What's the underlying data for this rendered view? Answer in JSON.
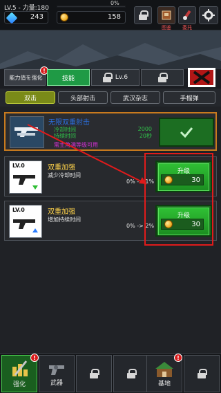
{
  "hud": {
    "level_power": "LV.5 - 力量:180",
    "progress_pct": "0%",
    "gems": "243",
    "gold": "158",
    "btn_illustrated_label": "图鉴",
    "btn_commission_label": "委托"
  },
  "tabs_top": [
    {
      "label": "能力值を强化"
    },
    {
      "label": "技能"
    },
    {
      "label": "Lv.6"
    },
    {
      "label": ""
    }
  ],
  "tabs_sub": [
    {
      "label": "双击"
    },
    {
      "label": "头部射击"
    },
    {
      "label": "武汉杂志"
    },
    {
      "label": "手榴弹"
    }
  ],
  "skill_active": {
    "title": "无限双重射击",
    "line1_label": "冷却时间",
    "line1_value": "2000",
    "line2_label": "持续时间",
    "line2_value": "20秒",
    "note": "需主角满等级可用"
  },
  "skills": [
    {
      "level": "LV.0",
      "name": "双重加强",
      "desc": "减少冷却时间",
      "change": "0% -> 1%",
      "button_label": "升级",
      "price": "30"
    },
    {
      "level": "LV.0",
      "name": "双重加强",
      "desc": "增加持续时间",
      "change": "0% -> 2%",
      "button_label": "升级",
      "price": "30"
    }
  ],
  "bottom_nav": [
    {
      "label": "强化"
    },
    {
      "label": "武器"
    },
    {
      "label": ""
    },
    {
      "label": ""
    },
    {
      "label": "基地"
    },
    {
      "label": ""
    }
  ],
  "colors": {
    "accent_green": "#2fbf34",
    "highlight_red": "#e11b1b",
    "active_tab": "#1fa24a"
  }
}
